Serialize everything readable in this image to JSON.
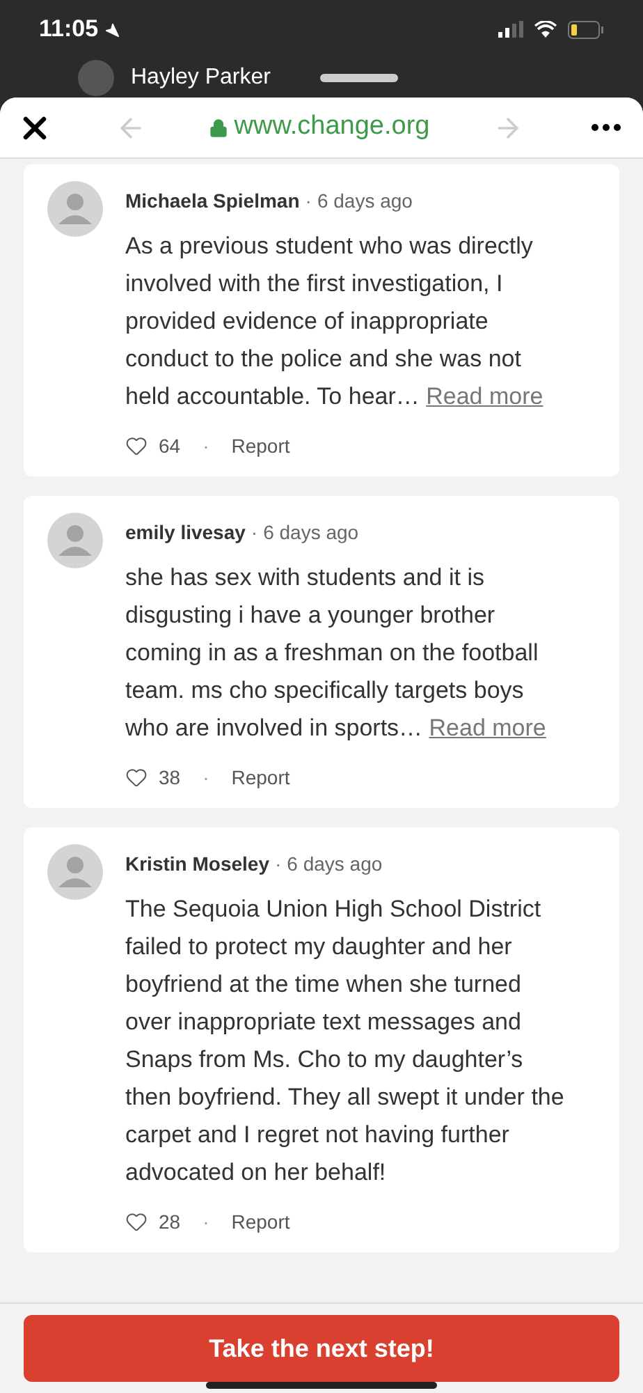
{
  "status_bar": {
    "time": "11:05"
  },
  "background_profile": {
    "name": "Hayley Parker"
  },
  "separator": "·",
  "browser": {
    "url": "www.change.org",
    "back_disabled": true,
    "forward_disabled": true
  },
  "comments": [
    {
      "author": "Michaela Spielman",
      "time": "6 days ago",
      "text": "As a previous student who was directly involved with the first investigation, I provided evidence of inappropriate conduct to the police and she was not held accountable. To hear…",
      "read_more": "Read more",
      "likes": "64",
      "report": "Report"
    },
    {
      "author": "emily livesay",
      "time": "6 days ago",
      "text": "she has sex with students and it is disgusting i have a younger brother coming in as a freshman on the football team. ms cho specifically targets boys who are involved in sports…",
      "read_more": "Read more",
      "likes": "38",
      "report": "Report"
    },
    {
      "author": "Kristin Moseley",
      "time": "6 days ago",
      "text": "The Sequoia Union High School District failed to protect my daughter and her boyfriend at the time when she turned over inappropriate text messages and Snaps from Ms. Cho to my daughter’s then boyfriend. They all swept it under the carpet and I regret not having further advocated on her behalf!",
      "likes": "28",
      "report": "Report"
    }
  ],
  "cta_button": "Take the next step!"
}
